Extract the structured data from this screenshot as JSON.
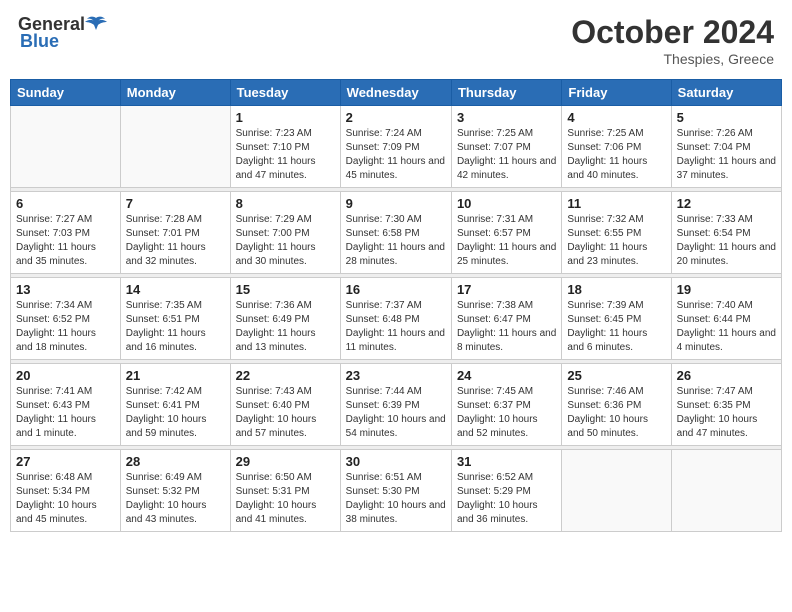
{
  "header": {
    "logo_general": "General",
    "logo_blue": "Blue",
    "month_year": "October 2024",
    "location": "Thespies, Greece"
  },
  "weekdays": [
    "Sunday",
    "Monday",
    "Tuesday",
    "Wednesday",
    "Thursday",
    "Friday",
    "Saturday"
  ],
  "weeks": [
    [
      {
        "day": "",
        "info": ""
      },
      {
        "day": "",
        "info": ""
      },
      {
        "day": "1",
        "info": "Sunrise: 7:23 AM\nSunset: 7:10 PM\nDaylight: 11 hours and 47 minutes."
      },
      {
        "day": "2",
        "info": "Sunrise: 7:24 AM\nSunset: 7:09 PM\nDaylight: 11 hours and 45 minutes."
      },
      {
        "day": "3",
        "info": "Sunrise: 7:25 AM\nSunset: 7:07 PM\nDaylight: 11 hours and 42 minutes."
      },
      {
        "day": "4",
        "info": "Sunrise: 7:25 AM\nSunset: 7:06 PM\nDaylight: 11 hours and 40 minutes."
      },
      {
        "day": "5",
        "info": "Sunrise: 7:26 AM\nSunset: 7:04 PM\nDaylight: 11 hours and 37 minutes."
      }
    ],
    [
      {
        "day": "6",
        "info": "Sunrise: 7:27 AM\nSunset: 7:03 PM\nDaylight: 11 hours and 35 minutes."
      },
      {
        "day": "7",
        "info": "Sunrise: 7:28 AM\nSunset: 7:01 PM\nDaylight: 11 hours and 32 minutes."
      },
      {
        "day": "8",
        "info": "Sunrise: 7:29 AM\nSunset: 7:00 PM\nDaylight: 11 hours and 30 minutes."
      },
      {
        "day": "9",
        "info": "Sunrise: 7:30 AM\nSunset: 6:58 PM\nDaylight: 11 hours and 28 minutes."
      },
      {
        "day": "10",
        "info": "Sunrise: 7:31 AM\nSunset: 6:57 PM\nDaylight: 11 hours and 25 minutes."
      },
      {
        "day": "11",
        "info": "Sunrise: 7:32 AM\nSunset: 6:55 PM\nDaylight: 11 hours and 23 minutes."
      },
      {
        "day": "12",
        "info": "Sunrise: 7:33 AM\nSunset: 6:54 PM\nDaylight: 11 hours and 20 minutes."
      }
    ],
    [
      {
        "day": "13",
        "info": "Sunrise: 7:34 AM\nSunset: 6:52 PM\nDaylight: 11 hours and 18 minutes."
      },
      {
        "day": "14",
        "info": "Sunrise: 7:35 AM\nSunset: 6:51 PM\nDaylight: 11 hours and 16 minutes."
      },
      {
        "day": "15",
        "info": "Sunrise: 7:36 AM\nSunset: 6:49 PM\nDaylight: 11 hours and 13 minutes."
      },
      {
        "day": "16",
        "info": "Sunrise: 7:37 AM\nSunset: 6:48 PM\nDaylight: 11 hours and 11 minutes."
      },
      {
        "day": "17",
        "info": "Sunrise: 7:38 AM\nSunset: 6:47 PM\nDaylight: 11 hours and 8 minutes."
      },
      {
        "day": "18",
        "info": "Sunrise: 7:39 AM\nSunset: 6:45 PM\nDaylight: 11 hours and 6 minutes."
      },
      {
        "day": "19",
        "info": "Sunrise: 7:40 AM\nSunset: 6:44 PM\nDaylight: 11 hours and 4 minutes."
      }
    ],
    [
      {
        "day": "20",
        "info": "Sunrise: 7:41 AM\nSunset: 6:43 PM\nDaylight: 11 hours and 1 minute."
      },
      {
        "day": "21",
        "info": "Sunrise: 7:42 AM\nSunset: 6:41 PM\nDaylight: 10 hours and 59 minutes."
      },
      {
        "day": "22",
        "info": "Sunrise: 7:43 AM\nSunset: 6:40 PM\nDaylight: 10 hours and 57 minutes."
      },
      {
        "day": "23",
        "info": "Sunrise: 7:44 AM\nSunset: 6:39 PM\nDaylight: 10 hours and 54 minutes."
      },
      {
        "day": "24",
        "info": "Sunrise: 7:45 AM\nSunset: 6:37 PM\nDaylight: 10 hours and 52 minutes."
      },
      {
        "day": "25",
        "info": "Sunrise: 7:46 AM\nSunset: 6:36 PM\nDaylight: 10 hours and 50 minutes."
      },
      {
        "day": "26",
        "info": "Sunrise: 7:47 AM\nSunset: 6:35 PM\nDaylight: 10 hours and 47 minutes."
      }
    ],
    [
      {
        "day": "27",
        "info": "Sunrise: 6:48 AM\nSunset: 5:34 PM\nDaylight: 10 hours and 45 minutes."
      },
      {
        "day": "28",
        "info": "Sunrise: 6:49 AM\nSunset: 5:32 PM\nDaylight: 10 hours and 43 minutes."
      },
      {
        "day": "29",
        "info": "Sunrise: 6:50 AM\nSunset: 5:31 PM\nDaylight: 10 hours and 41 minutes."
      },
      {
        "day": "30",
        "info": "Sunrise: 6:51 AM\nSunset: 5:30 PM\nDaylight: 10 hours and 38 minutes."
      },
      {
        "day": "31",
        "info": "Sunrise: 6:52 AM\nSunset: 5:29 PM\nDaylight: 10 hours and 36 minutes."
      },
      {
        "day": "",
        "info": ""
      },
      {
        "day": "",
        "info": ""
      }
    ]
  ]
}
